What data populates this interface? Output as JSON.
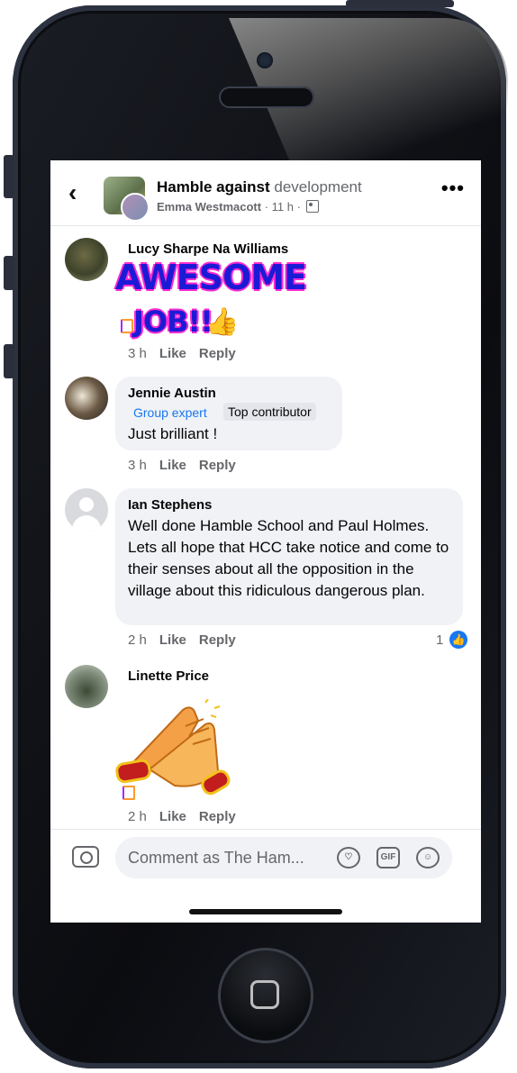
{
  "header": {
    "group_name_part1": "Hamble against ",
    "group_name_part2": "development",
    "poster": "Emma Westmacott",
    "time": " · 11 h · ",
    "more_label": "•••"
  },
  "comments": [
    {
      "author": "Lucy Sharpe Na Williams",
      "sticker_line1": "AWESOME",
      "sticker_line2": "JOB!!",
      "sticker_emoji": "👍",
      "time": "3 h",
      "like": "Like",
      "reply": "Reply"
    },
    {
      "author": "Jennie Austin",
      "badge_expert": "Group expert",
      "badge_top": "Top contributor",
      "text": "Just brilliant !",
      "time": "3 h",
      "like": "Like",
      "reply": "Reply"
    },
    {
      "author": "Ian Stephens",
      "text": "Well done Hamble School and Paul Holmes. Lets all hope that HCC take notice and come to their senses about all the opposition in the village about this ridiculous dangerous plan.",
      "time": "2 h",
      "like": "Like",
      "reply": "Reply",
      "reaction_count": "1"
    },
    {
      "author": "Linette Price",
      "time": "2 h",
      "like": "Like",
      "reply": "Reply"
    }
  ],
  "composer": {
    "placeholder": "Comment as The Ham...",
    "gif_label": "GIF"
  },
  "icons": {
    "back": "chevron-left-icon",
    "camera": "camera-icon",
    "avatar_sticker": "sticker-icon",
    "gif": "gif-icon",
    "emoji": "emoji-icon",
    "like": "like-thumb-icon"
  },
  "colors": {
    "accent": "#1877f2",
    "bubble": "#f0f2f5",
    "secondary_text": "#65676b"
  }
}
